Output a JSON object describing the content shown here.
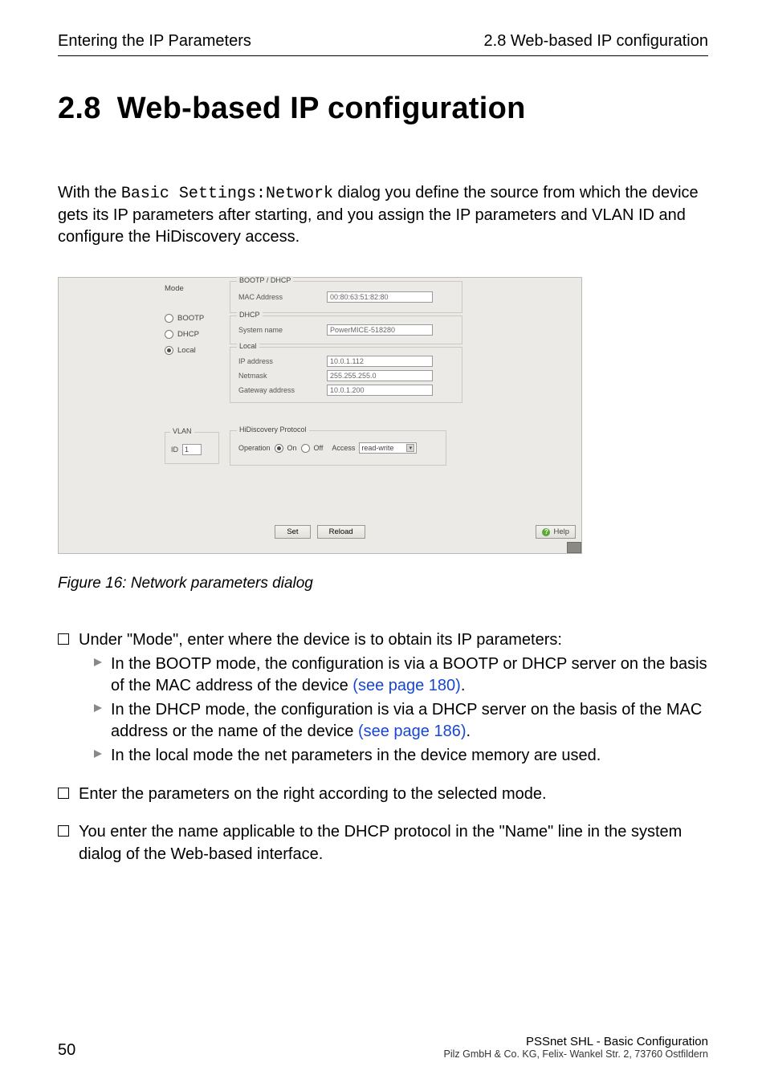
{
  "header": {
    "left": "Entering the IP Parameters",
    "right": "2.8 Web-based IP configuration"
  },
  "chapter": {
    "number": "2.8",
    "title": "Web-based IP configuration"
  },
  "intro": {
    "pre": "With the ",
    "mono": "Basic Settings:Network",
    "post": " dialog you define the source from which the device gets its IP parameters after starting, and you assign the IP parameters and VLAN ID and configure the HiDiscovery access."
  },
  "dialog": {
    "mode_label": "Mode",
    "radios": {
      "bootp": "BOOTP",
      "dhcp": "DHCP",
      "local": "Local"
    },
    "boot_legend": "BOOTP / DHCP",
    "mac_label": "MAC Address",
    "mac_value": "00:80:63:51:82:80",
    "dhcp_legend": "DHCP",
    "sysname_label": "System name",
    "sysname_value": "PowerMICE-518280",
    "local_legend": "Local",
    "ip_label": "IP address",
    "ip_value": "10.0.1.112",
    "nm_label": "Netmask",
    "nm_value": "255.255.255.0",
    "gw_label": "Gateway address",
    "gw_value": "10.0.1.200",
    "vlan_legend": "VLAN",
    "vlan_id_label": "ID",
    "vlan_id_value": "1",
    "hid_legend": "HiDiscovery Protocol",
    "hid_op": "Operation",
    "hid_on": "On",
    "hid_off": "Off",
    "hid_access_label": "Access",
    "hid_access_value": "read-write",
    "set_btn": "Set",
    "reload_btn": "Reload",
    "help_btn": "Help"
  },
  "caption": "Figure 16: Network parameters dialog",
  "tasks": {
    "t1": "Under \"Mode\", enter where the device is to obtain its IP parameters:",
    "t1a_pre": "In the BOOTP mode, the configuration is via a BOOTP or DHCP server on the basis of the MAC address of the device ",
    "t1a_link": "(see page 180)",
    "t1b_pre": "In the DHCP mode, the configuration is via a DHCP server on the basis of the MAC address or the name of the device ",
    "t1b_link": "(see page 186)",
    "t1c": "In the local mode the net parameters in the device memory are used.",
    "t2": "Enter the parameters on the right according to the selected mode.",
    "t3": "You enter the name applicable to the DHCP protocol in the \"Name\" line in the system dialog of the Web-based interface."
  },
  "footer": {
    "page": "50",
    "line1": "PSSnet SHL - Basic Configuration",
    "line2": "Pilz GmbH & Co. KG, Felix- Wankel Str. 2, 73760 Ostfildern"
  }
}
